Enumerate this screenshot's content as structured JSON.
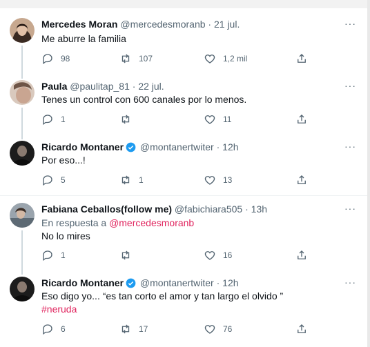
{
  "tweets": [
    {
      "name": "Mercedes Moran",
      "handle": "@mercedesmoranb",
      "sep": "·",
      "time": "21 jul.",
      "text": "Me aburre la familia",
      "replies": "98",
      "retweets": "107",
      "likes": "1,2 mil"
    },
    {
      "name": "Paula",
      "handle": "@paulitap_81",
      "sep": "·",
      "time": "22 jul.",
      "text": "Tenes un control con 600 canales por lo menos.",
      "replies": "1",
      "retweets": "",
      "likes": "11"
    },
    {
      "name": "Ricardo Montaner",
      "handle": "@montanertwiter",
      "sep": "·",
      "time": "12h",
      "text": "Por eso...!",
      "replies": "5",
      "retweets": "1",
      "likes": "13"
    },
    {
      "name": "Fabiana Ceballos(follow me)",
      "handle": "@fabichiara505",
      "sep": "·",
      "time": "13h",
      "reply_prefix": "En respuesta a",
      "reply_mention": "@mercedesmoranb",
      "text": "No lo mires",
      "replies": "1",
      "retweets": "",
      "likes": "16"
    },
    {
      "name": "Ricardo Montaner",
      "handle": "@montanertwiter",
      "sep": "·",
      "time": "12h",
      "text": "Eso digo yo... “es tan corto el amor y tan largo el olvido ”",
      "hashtag": "#neruda",
      "replies": "6",
      "retweets": "17",
      "likes": "76"
    }
  ],
  "more_label": "···",
  "icons": {
    "reply": "reply-icon",
    "retweet": "retweet-icon",
    "like": "heart-icon",
    "share": "share-icon",
    "more": "more-icon",
    "verified": "verified-badge-icon"
  },
  "colors": {
    "link": "#e0245e",
    "muted": "#536471",
    "verified": "#1d9bf0"
  }
}
